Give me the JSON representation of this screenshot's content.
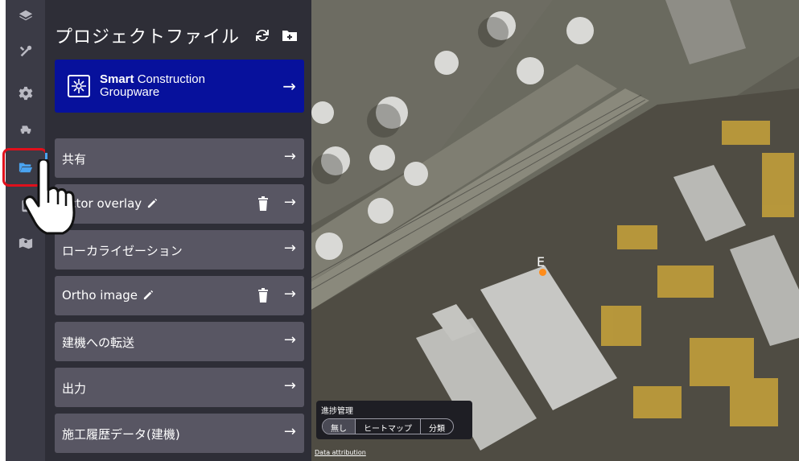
{
  "panel": {
    "title": "プロジェクトファイル",
    "tools": [
      "refresh-icon",
      "add-folder-icon"
    ]
  },
  "smart_construction": {
    "line1": "Smart",
    "line1b": " Construction",
    "line2": "Groupware"
  },
  "rows": [
    {
      "label": "共有"
    },
    {
      "label": "ector overlay"
    },
    {
      "label": "ローカライゼーション"
    },
    {
      "label": "Ortho image"
    },
    {
      "label": "建機への転送"
    },
    {
      "label": "出力"
    },
    {
      "label": "施工履歴データ(建機)"
    }
  ],
  "arrow": "→",
  "rail": {
    "icons": [
      "layers-icon",
      "tools-icon",
      "gear-icon",
      "excavator-icon",
      "folder-open-icon",
      "tablet-icon",
      "map-icon"
    ],
    "active": "folder-open-icon"
  },
  "map": {
    "marker_label": "E",
    "progress_title": "進捗管理",
    "progress_options": [
      "無し",
      "ヒートマップ",
      "分類"
    ],
    "progress_selected": "無し",
    "attribution": "Data attribution"
  },
  "colors": {
    "panel_bg": "#2e2e37",
    "row_bg": "#585663",
    "scg_bg": "#07119c",
    "active_accent": "#4aa3f0",
    "highlight": "#e0101c",
    "marker": "#ff8c1a"
  }
}
